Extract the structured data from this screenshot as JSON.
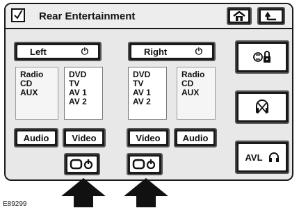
{
  "title": "Rear Entertainment",
  "left": {
    "label": "Left",
    "power_symbol": "⏻"
  },
  "right": {
    "label": "Right",
    "power_symbol": "⏻"
  },
  "sources": {
    "left_radio": "Radio\nCD\nAUX",
    "left_dvd": "DVD\nTV\nAV 1\nAV 2",
    "right_dvd": "DVD\nTV\nAV 1\nAV 2",
    "right_radio": "Radio\nCD\nAUX"
  },
  "buttons": {
    "left_audio": "Audio",
    "left_video": "Video",
    "right_video": "Video",
    "right_audio": "Audio",
    "avl": "AVL"
  },
  "caption": "E89299"
}
